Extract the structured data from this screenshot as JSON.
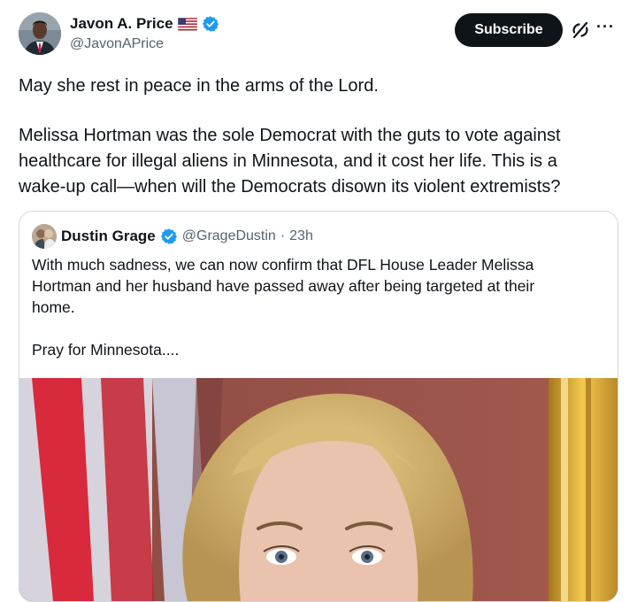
{
  "post": {
    "author_name": "Javon A. Price",
    "author_handle": "@JavonAPrice",
    "subscribe_label": "Subscribe",
    "more_label": "···",
    "text_lines": [
      "May she rest in peace in the arms of the Lord.",
      "Melissa Hortman was the sole Democrat with the guts to vote against",
      "healthcare for illegal aliens in Minnesota, and it cost her life. This is a",
      "wake-up call—when will the Democrats disown its violent extremists?"
    ]
  },
  "quote": {
    "author_name": "Dustin Grage",
    "author_handle": "@GrageDustin",
    "separator": "·",
    "time": "23h",
    "text_lines": [
      "With much sadness, we can now confirm that DFL House Leader Melissa",
      "Hortman and her husband have passed away after being targeted at their",
      "home.",
      "Pray for Minnesota...."
    ]
  },
  "icons": {
    "flag": "us-flag-icon",
    "verified": "verified-badge-icon",
    "grok": "grok-icon",
    "more": "more-icon"
  },
  "colors": {
    "verified": "#1d9bf0",
    "text": "#0f1419",
    "secondary": "#536471",
    "button": "#0f1419",
    "border": "#cfd9de"
  }
}
